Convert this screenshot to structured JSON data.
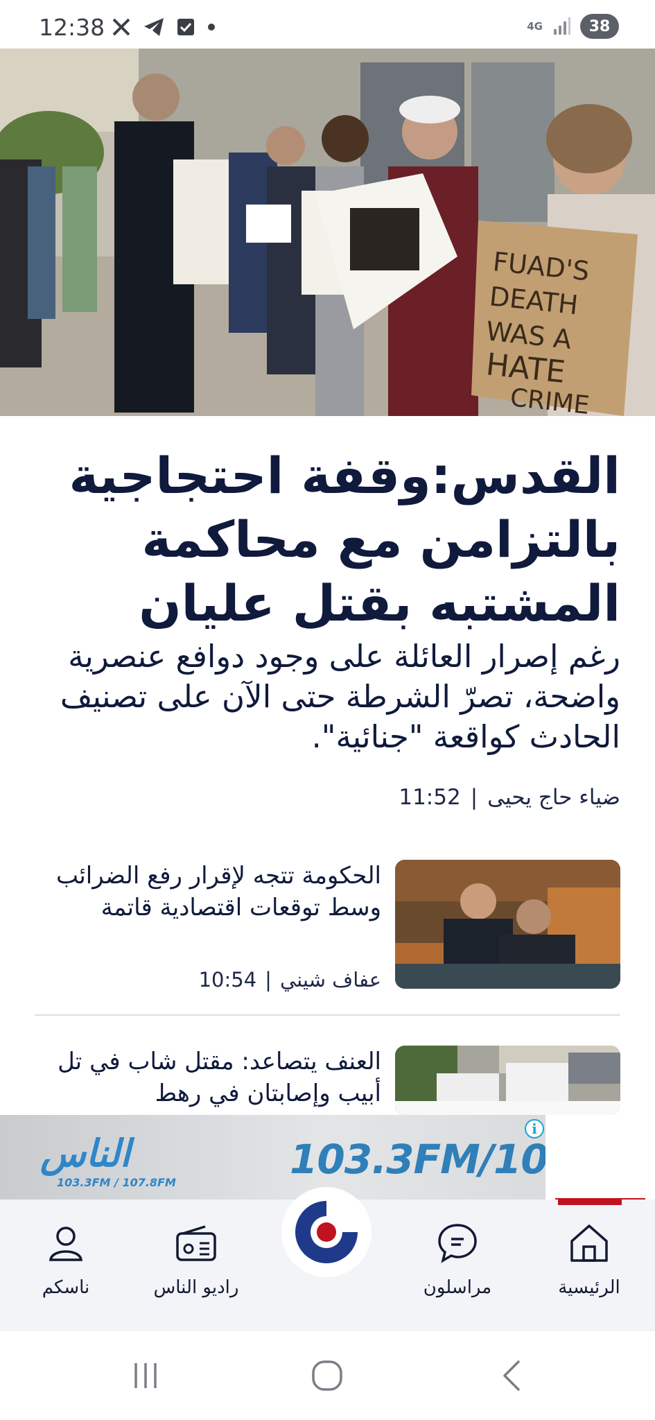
{
  "status_bar": {
    "time": "12:38",
    "network": "4G",
    "battery": "38"
  },
  "hero": {
    "sign_text": "FUAD'S DEATH WAS A HATE CRIME"
  },
  "main_article": {
    "headline": "القدس:وقفة احتجاجية بالتزامن مع محاكمة المشتبه بقتل عليان",
    "subheadline": "رغم إصرار العائلة على وجود دوافع عنصرية واضحة، تصرّ الشرطة حتى الآن على تصنيف الحادث كواقعة \"جنائية\".",
    "author": "ضياء حاج يحيى",
    "separator": "|",
    "time": "11:52"
  },
  "articles": [
    {
      "title": "الحكومة تتجه لإقرار رفع الضرائب وسط توقعات اقتصادية قاتمة",
      "author": "عفاف شيني",
      "separator": "|",
      "time": "10:54"
    },
    {
      "title": "العنف يتصاعد: مقتل شاب في تل أبيب وإصابتان في رهط"
    }
  ],
  "ad": {
    "frequencies": "103.3FM/107.8FM",
    "logo_text": "الناس",
    "logo_sub": "103.3FM / 107.8FM"
  },
  "bottom_nav": {
    "items": [
      {
        "label": "ناسكم",
        "icon": "person-icon"
      },
      {
        "label": "راديو الناس",
        "icon": "radio-icon"
      },
      {
        "label": "",
        "icon": "app-logo-icon"
      },
      {
        "label": "مراسلون",
        "icon": "chat-icon"
      },
      {
        "label": "الرئيسية",
        "icon": "home-icon"
      }
    ],
    "active": "الرئيسية"
  },
  "colors": {
    "headline": "#0f1a3c",
    "accent_red": "#c1121f",
    "logo_blue": "#1f3a8a",
    "ad_blue": "#2f7fb8"
  }
}
